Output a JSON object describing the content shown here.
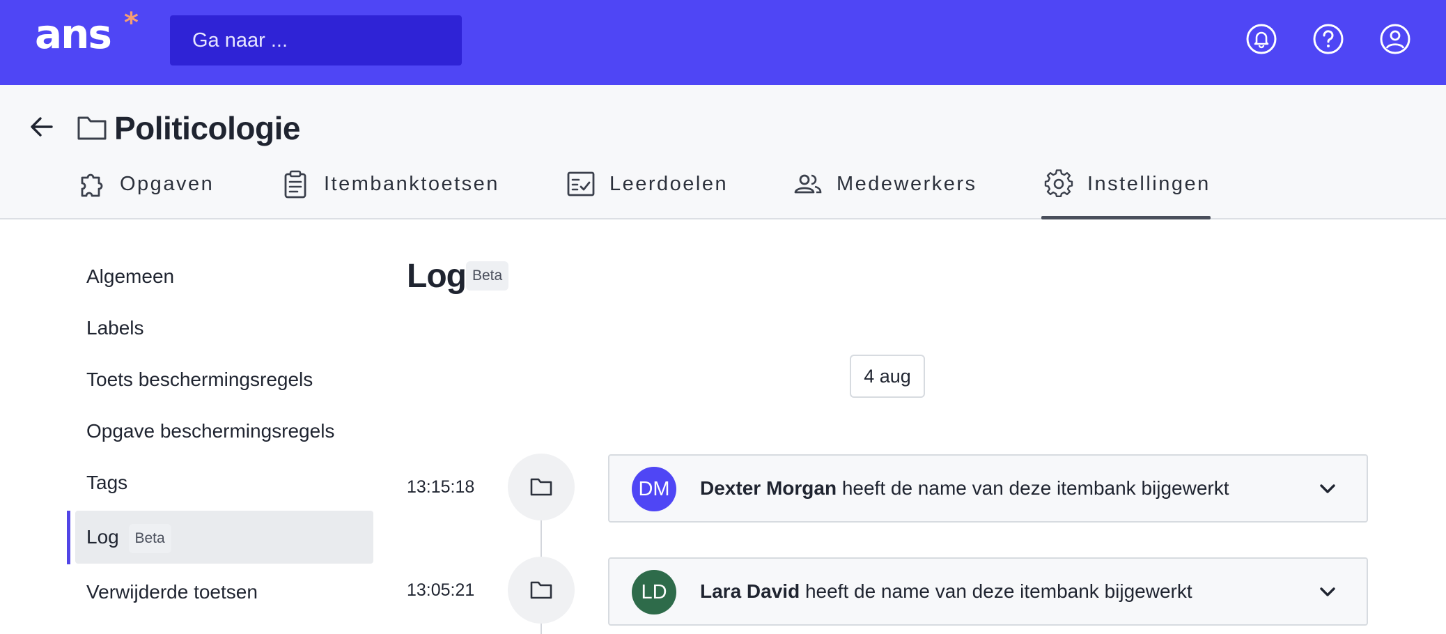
{
  "topbar": {
    "logo_text": "ans",
    "logo_star": "*",
    "search_placeholder": "Ga naar ...",
    "icons": [
      "notifications-bell-icon",
      "help-icon",
      "account-icon"
    ],
    "brand_color": "#4f46f5"
  },
  "header": {
    "title": "Politicologie",
    "title_icon": "folder-icon",
    "tabs": [
      {
        "label": "Opgaven",
        "icon": "puzzle-icon"
      },
      {
        "label": "Itembanktoetsen",
        "icon": "clipboard-icon"
      },
      {
        "label": "Leerdoelen",
        "icon": "checklist-icon"
      },
      {
        "label": "Medewerkers",
        "icon": "people-icon"
      },
      {
        "label": "Instellingen",
        "icon": "gear-icon",
        "active": true
      }
    ]
  },
  "sidebar": {
    "items": [
      {
        "label": "Algemeen"
      },
      {
        "label": "Labels"
      },
      {
        "label": "Toets beschermingsregels"
      },
      {
        "label": "Opgave beschermingsregels"
      },
      {
        "label": "Tags"
      },
      {
        "label": "Log",
        "badge": "Beta",
        "active": true
      },
      {
        "label": "Verwijderde toetsen"
      }
    ]
  },
  "main": {
    "title": "Log",
    "badge": "Beta",
    "date": "4 aug",
    "entries": [
      {
        "time": "13:15:18",
        "initials": "DM",
        "avatar_color": "#4f46f5",
        "user": "Dexter Morgan",
        "action": " heeft de name van deze itembank bijgewerkt"
      },
      {
        "time": "13:05:21",
        "initials": "LD",
        "avatar_color": "#2e6b4a",
        "user": "Lara David",
        "action": " heeft de name van deze itembank bijgewerkt"
      }
    ]
  }
}
